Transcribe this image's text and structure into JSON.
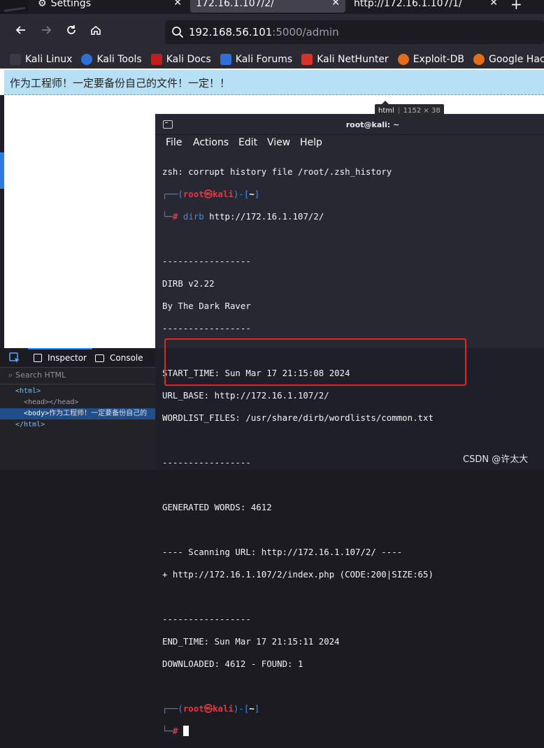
{
  "browser": {
    "tabs": [
      {
        "label": "Settings",
        "icon": "gear-icon"
      },
      {
        "label": "172.16.1.107/2/",
        "active": true
      },
      {
        "label": "http://172.16.1.107/1/"
      }
    ],
    "new_tab_glyph": "+",
    "close_glyph": "✕",
    "url": {
      "host": "192.168.56.101",
      "rest": ":5000/admin"
    },
    "bookmarks": [
      {
        "label": "Kali Linux",
        "icon": "kali-dragon-icon",
        "color": "#2b2a33"
      },
      {
        "label": "Kali Tools",
        "icon": "kali-tools-icon",
        "color": "#d8362b"
      },
      {
        "label": "Kali Docs",
        "icon": "kali-docs-icon",
        "color": "#c41d1d"
      },
      {
        "label": "Kali Forums",
        "icon": "kali-forums-icon",
        "color": "#2f6fd6"
      },
      {
        "label": "Kali NetHunter",
        "icon": "kali-nethunter-icon",
        "color": "#d6332b"
      },
      {
        "label": "Exploit-DB",
        "icon": "exploit-db-icon",
        "color": "#e26d1c"
      },
      {
        "label": "Google Hacking DB",
        "icon": "ghdb-icon",
        "color": "#e26d1c"
      }
    ]
  },
  "page": {
    "banner_text": "作为工程师！一定要备份自己的文件！一定！！",
    "tooltip": {
      "tag": "html",
      "size": "1152 × 38"
    }
  },
  "devtools": {
    "tabs": [
      "Inspector",
      "Console"
    ],
    "search_placeholder": "Search HTML",
    "tree": [
      {
        "open": "<html>",
        "text": "",
        "indent": 1
      },
      {
        "open": "<head></head>",
        "text": "",
        "indent": 2
      },
      {
        "open": "<body>",
        "text": "作为工程师！一定要备份自己的",
        "indent": 2,
        "selected": true
      },
      {
        "open": "</html>",
        "text": "",
        "indent": 1
      }
    ]
  },
  "terminal": {
    "title": "root@kali: ~",
    "menu": [
      "File",
      "Actions",
      "Edit",
      "View",
      "Help"
    ],
    "prompt": {
      "open": "┌──(",
      "user": "root",
      "skull": "㉿",
      "host": "kali",
      "close": ")-[",
      "dir": "~",
      "end": "]",
      "cont": "└─",
      "hash": "#"
    },
    "lines": {
      "l1": "zsh: corrupt history file /root/.zsh_history",
      "cmd_name": "dirb",
      "cmd_args": " http://172.16.1.107/2/",
      "rule": "-----------------",
      "l3": "DIRB v2.22",
      "l4": "By The Dark Raver",
      "l5": "START_TIME: Sun Mar 17 21:15:08 2024",
      "l6": "URL_BASE: http://172.16.1.107/2/",
      "l7": "WORDLIST_FILES: /usr/share/dirb/wordlists/common.txt",
      "l8": "GENERATED WORDS: 4612",
      "l9": "---- Scanning URL: http://172.16.1.107/2/ ----",
      "l10": "+ http://172.16.1.107/2/index.php (CODE:200|SIZE:65)",
      "l11": "END_TIME: Sun Mar 17 21:15:11 2024",
      "l12": "DOWNLOADED: 4612 - FOUND: 1"
    }
  },
  "watermark": "CSDN @许太大"
}
